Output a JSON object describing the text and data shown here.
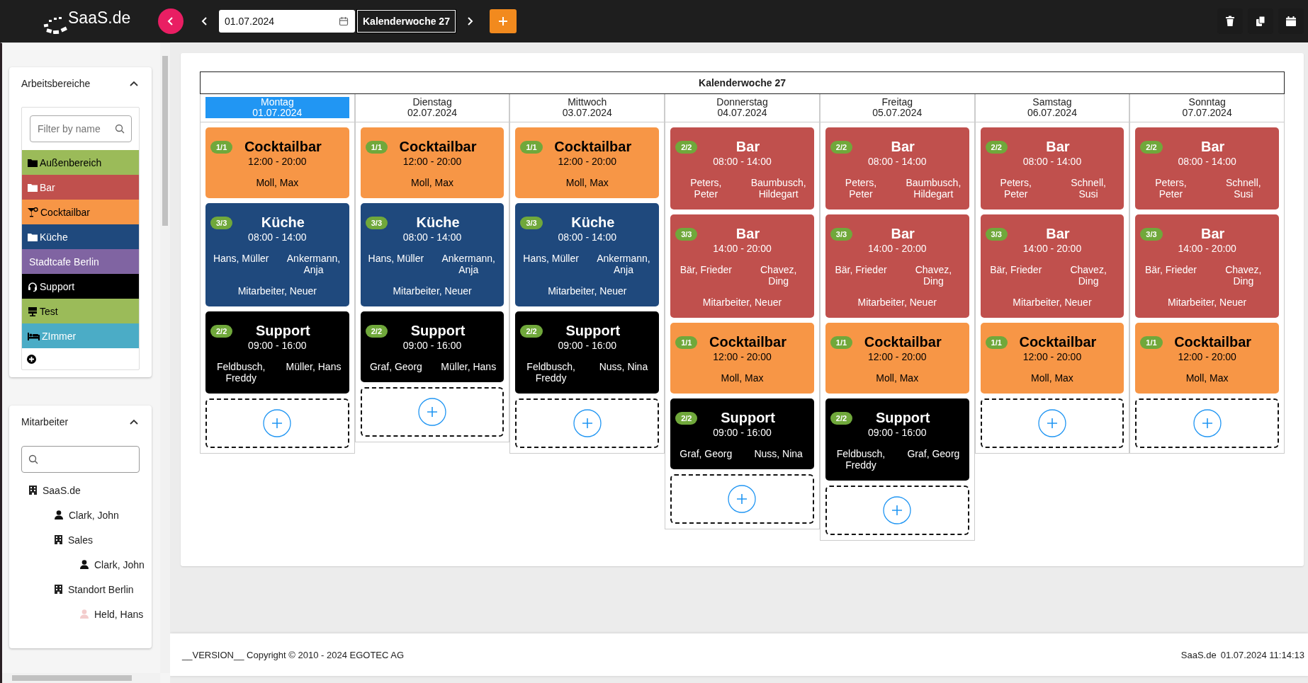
{
  "topbar": {
    "logo": "SaaS.de",
    "date": "01.07.2024",
    "week_label": "Kalenderwoche 27"
  },
  "sidebar": {
    "areas": {
      "title": "Arbeitsbereiche",
      "expanded": true,
      "filter_placeholder": "Filter by name",
      "items": [
        {
          "label": "Außenbereich",
          "color": "#9bbb59",
          "kind": "folder"
        },
        {
          "label": "Bar",
          "color": "#c0504d",
          "kind": "folder"
        },
        {
          "label": "Cocktailbar",
          "color": "#f79646",
          "kind": "cocktail"
        },
        {
          "label": "Küche",
          "color": "#1f497d",
          "kind": "folder"
        },
        {
          "label": "Stadtcafe Berlin",
          "color": "#8064a2",
          "kind": "plain"
        },
        {
          "label": "Support",
          "color": "#000000",
          "kind": "headset"
        },
        {
          "label": "Test",
          "color": "#9bbb59",
          "kind": "sign"
        },
        {
          "label": "ZImmer",
          "color": "#4bacc6",
          "kind": "bed"
        }
      ]
    },
    "employees": {
      "title": "Mitarbeiter",
      "expanded": true,
      "tree": [
        {
          "label": "SaaS.de",
          "kind": "building",
          "children": [
            {
              "label": "Clark, John",
              "kind": "person",
              "inactive": false
            },
            {
              "label": "Sales",
              "kind": "building",
              "children": [
                {
                  "label": "Clark, John",
                  "kind": "person",
                  "inactive": false
                }
              ]
            },
            {
              "label": "Standort Berlin",
              "kind": "building",
              "children": [
                {
                  "label": "Held, Hans",
                  "kind": "person",
                  "inactive": true
                }
              ]
            }
          ]
        }
      ]
    }
  },
  "calendar": {
    "title": "Kalenderwoche 27",
    "days": [
      {
        "weekday": "Montag",
        "date": "01.07.2024",
        "selected": true,
        "shifts": [
          {
            "area": "Cocktailbar",
            "time": "12:00 - 20:00",
            "staffing": "1/1",
            "color": "#f79646",
            "employees": [
              "Moll, Max"
            ]
          },
          {
            "area": "Küche",
            "time": "08:00 - 14:00",
            "staffing": "3/3",
            "color": "#1f497d",
            "employees": [
              "Hans, Müller",
              "Ankermann, Anja",
              "Mitarbeiter, Neuer"
            ]
          },
          {
            "area": "Support",
            "time": "09:00 - 16:00",
            "staffing": "2/2",
            "color": "#000000",
            "employees": [
              "Feldbusch, Freddy",
              "Müller, Hans"
            ]
          }
        ]
      },
      {
        "weekday": "Dienstag",
        "date": "02.07.2024",
        "selected": false,
        "shifts": [
          {
            "area": "Cocktailbar",
            "time": "12:00 - 20:00",
            "staffing": "1/1",
            "color": "#f79646",
            "employees": [
              "Moll, Max"
            ]
          },
          {
            "area": "Küche",
            "time": "08:00 - 14:00",
            "staffing": "3/3",
            "color": "#1f497d",
            "employees": [
              "Hans, Müller",
              "Ankermann, Anja",
              "Mitarbeiter, Neuer"
            ]
          },
          {
            "area": "Support",
            "time": "09:00 - 16:00",
            "staffing": "2/2",
            "color": "#000000",
            "employees": [
              "Graf, Georg",
              "Müller, Hans"
            ]
          }
        ]
      },
      {
        "weekday": "Mittwoch",
        "date": "03.07.2024",
        "selected": false,
        "shifts": [
          {
            "area": "Cocktailbar",
            "time": "12:00 - 20:00",
            "staffing": "1/1",
            "color": "#f79646",
            "employees": [
              "Moll, Max"
            ]
          },
          {
            "area": "Küche",
            "time": "08:00 - 14:00",
            "staffing": "3/3",
            "color": "#1f497d",
            "employees": [
              "Hans, Müller",
              "Ankermann, Anja",
              "Mitarbeiter, Neuer"
            ]
          },
          {
            "area": "Support",
            "time": "09:00 - 16:00",
            "staffing": "2/2",
            "color": "#000000",
            "employees": [
              "Feldbusch, Freddy",
              "Nuss, Nina"
            ]
          }
        ]
      },
      {
        "weekday": "Donnerstag",
        "date": "04.07.2024",
        "selected": false,
        "shifts": [
          {
            "area": "Bar",
            "time": "08:00 - 14:00",
            "staffing": "2/2",
            "color": "#c0504d",
            "employees": [
              "Peters, Peter",
              "Baumbusch, Hildegart"
            ]
          },
          {
            "area": "Bar",
            "time": "14:00 - 20:00",
            "staffing": "3/3",
            "color": "#c0504d",
            "employees": [
              "Bär, Frieder",
              "Chavez, Ding",
              "Mitarbeiter, Neuer"
            ]
          },
          {
            "area": "Cocktailbar",
            "time": "12:00 - 20:00",
            "staffing": "1/1",
            "color": "#f79646",
            "employees": [
              "Moll, Max"
            ]
          },
          {
            "area": "Support",
            "time": "09:00 - 16:00",
            "staffing": "2/2",
            "color": "#000000",
            "employees": [
              "Graf, Georg",
              "Nuss, Nina"
            ]
          }
        ]
      },
      {
        "weekday": "Freitag",
        "date": "05.07.2024",
        "selected": false,
        "shifts": [
          {
            "area": "Bar",
            "time": "08:00 - 14:00",
            "staffing": "2/2",
            "color": "#c0504d",
            "employees": [
              "Peters, Peter",
              "Baumbusch, Hildegart"
            ]
          },
          {
            "area": "Bar",
            "time": "14:00 - 20:00",
            "staffing": "3/3",
            "color": "#c0504d",
            "employees": [
              "Bär, Frieder",
              "Chavez, Ding",
              "Mitarbeiter, Neuer"
            ]
          },
          {
            "area": "Cocktailbar",
            "time": "12:00 - 20:00",
            "staffing": "1/1",
            "color": "#f79646",
            "employees": [
              "Moll, Max"
            ]
          },
          {
            "area": "Support",
            "time": "09:00 - 16:00",
            "staffing": "2/2",
            "color": "#000000",
            "employees": [
              "Feldbusch, Freddy",
              "Graf, Georg"
            ]
          }
        ]
      },
      {
        "weekday": "Samstag",
        "date": "06.07.2024",
        "selected": false,
        "shifts": [
          {
            "area": "Bar",
            "time": "08:00 - 14:00",
            "staffing": "2/2",
            "color": "#c0504d",
            "employees": [
              "Peters, Peter",
              "Schnell, Susi"
            ]
          },
          {
            "area": "Bar",
            "time": "14:00 - 20:00",
            "staffing": "3/3",
            "color": "#c0504d",
            "employees": [
              "Bär, Frieder",
              "Chavez, Ding",
              "Mitarbeiter, Neuer"
            ]
          },
          {
            "area": "Cocktailbar",
            "time": "12:00 - 20:00",
            "staffing": "1/1",
            "color": "#f79646",
            "employees": [
              "Moll, Max"
            ]
          }
        ]
      },
      {
        "weekday": "Sonntag",
        "date": "07.07.2024",
        "selected": false,
        "shifts": [
          {
            "area": "Bar",
            "time": "08:00 - 14:00",
            "staffing": "2/2",
            "color": "#c0504d",
            "employees": [
              "Peters, Peter",
              "Schnell, Susi"
            ]
          },
          {
            "area": "Bar",
            "time": "14:00 - 20:00",
            "staffing": "3/3",
            "color": "#c0504d",
            "employees": [
              "Bär, Frieder",
              "Chavez, Ding",
              "Mitarbeiter, Neuer"
            ]
          },
          {
            "area": "Cocktailbar",
            "time": "12:00 - 20:00",
            "staffing": "1/1",
            "color": "#f79646",
            "employees": [
              "Moll, Max"
            ]
          }
        ]
      }
    ]
  },
  "footer": {
    "copyright": "__VERSION__ Copyright © 2010 - 2024 EGOTEC AG",
    "site": "SaaS.de",
    "timestamp": "01.07.2024 11:14:13"
  }
}
